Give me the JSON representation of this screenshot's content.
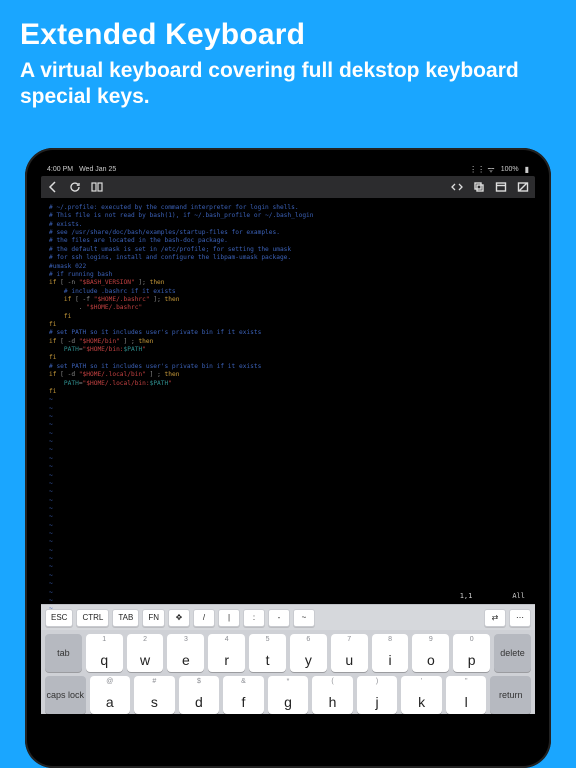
{
  "hero": {
    "title": "Extended Keyboard",
    "subtitle": "A virtual keyboard covering full dekstop keyboard special keys."
  },
  "status": {
    "time": "4:00 PM",
    "date": "Wed Jan 25",
    "battery": "100%"
  },
  "terminal": {
    "lines": [
      {
        "cls": "c-comment",
        "t": "# ~/.profile: executed by the command interpreter for login shells."
      },
      {
        "cls": "c-comment",
        "t": "# This file is not read by bash(1), if ~/.bash_profile or ~/.bash_login"
      },
      {
        "cls": "c-comment",
        "t": "# exists."
      },
      {
        "cls": "c-comment",
        "t": "# see /usr/share/doc/bash/examples/startup-files for examples."
      },
      {
        "cls": "c-comment",
        "t": "# the files are located in the bash-doc package."
      },
      {
        "cls": "",
        "t": ""
      },
      {
        "cls": "c-comment",
        "t": "# the default umask is set in /etc/profile; for setting the umask"
      },
      {
        "cls": "c-comment",
        "t": "# for ssh logins, install and configure the libpam-umask package."
      },
      {
        "cls": "c-comment",
        "t": "#umask 022"
      },
      {
        "cls": "",
        "t": ""
      },
      {
        "cls": "c-comment",
        "t": "# if running bash"
      },
      {
        "raw": "<span class='c-kw'>if</span> [ -n <span class='c-str'>\"$BASH_VERSION\"</span> ]; <span class='c-kw'>then</span>"
      },
      {
        "raw": "    <span class='c-comment'># include .bashrc if it exists</span>"
      },
      {
        "raw": "    <span class='c-kw'>if</span> [ -f <span class='c-str'>\"$HOME</span><span class='c-path'>/.bashrc</span><span class='c-str'>\"</span> ]; <span class='c-kw'>then</span>"
      },
      {
        "raw": "        . <span class='c-str'>\"$HOME</span><span class='c-path'>/.bashrc</span><span class='c-str'>\"</span>"
      },
      {
        "raw": "    <span class='c-kw'>fi</span>"
      },
      {
        "raw": "<span class='c-kw'>fi</span>"
      },
      {
        "cls": "",
        "t": ""
      },
      {
        "cls": "c-comment",
        "t": "# set PATH so it includes user's private bin if it exists"
      },
      {
        "raw": "<span class='c-kw'>if</span> [ -d <span class='c-str'>\"$HOME</span><span class='c-path'>/bin</span><span class='c-str'>\"</span> ] ; <span class='c-kw'>then</span>"
      },
      {
        "raw": "    <span class='c-var'>PATH</span>=<span class='c-str'>\"$HOME</span><span class='c-path'>/bin:</span><span class='c-var'>$PATH</span><span class='c-str'>\"</span>"
      },
      {
        "raw": "<span class='c-kw'>fi</span>"
      },
      {
        "cls": "",
        "t": ""
      },
      {
        "cls": "c-comment",
        "t": "# set PATH so it includes user's private bin if it exists"
      },
      {
        "raw": "<span class='c-kw'>if</span> [ -d <span class='c-str'>\"$HOME</span><span class='c-path'>/.local/bin</span><span class='c-str'>\"</span> ] ; <span class='c-kw'>then</span>"
      },
      {
        "raw": "    <span class='c-var'>PATH</span>=<span class='c-str'>\"$HOME</span><span class='c-path'>/.local/bin:</span><span class='c-var'>$PATH</span><span class='c-str'>\"</span>"
      },
      {
        "raw": "<span class='c-kw'>fi</span>"
      }
    ],
    "tildes": 26,
    "position": "1,1",
    "scroll": "All"
  },
  "extkeys": [
    "ESC",
    "CTRL",
    "TAB",
    "FN",
    "✥",
    "/",
    "|",
    ":",
    "-",
    "~"
  ],
  "extkeys_right": [
    "⇄",
    "⋯"
  ],
  "kbd": {
    "row1": [
      {
        "alt": "1",
        "main": "q"
      },
      {
        "alt": "2",
        "main": "w"
      },
      {
        "alt": "3",
        "main": "e"
      },
      {
        "alt": "4",
        "main": "r"
      },
      {
        "alt": "5",
        "main": "t"
      },
      {
        "alt": "6",
        "main": "y"
      },
      {
        "alt": "7",
        "main": "u"
      },
      {
        "alt": "8",
        "main": "i"
      },
      {
        "alt": "9",
        "main": "o"
      },
      {
        "alt": "0",
        "main": "p"
      }
    ],
    "row2": [
      {
        "alt": "@",
        "main": "a"
      },
      {
        "alt": "#",
        "main": "s"
      },
      {
        "alt": "$",
        "main": "d"
      },
      {
        "alt": "&",
        "main": "f"
      },
      {
        "alt": "*",
        "main": "g"
      },
      {
        "alt": "(",
        "main": "h"
      },
      {
        "alt": ")",
        "main": "j"
      },
      {
        "alt": "'",
        "main": "k"
      },
      {
        "alt": "\"",
        "main": "l"
      }
    ],
    "mods": {
      "tab": "tab",
      "delete": "delete",
      "caps": "caps lock",
      "ret": "return"
    }
  }
}
